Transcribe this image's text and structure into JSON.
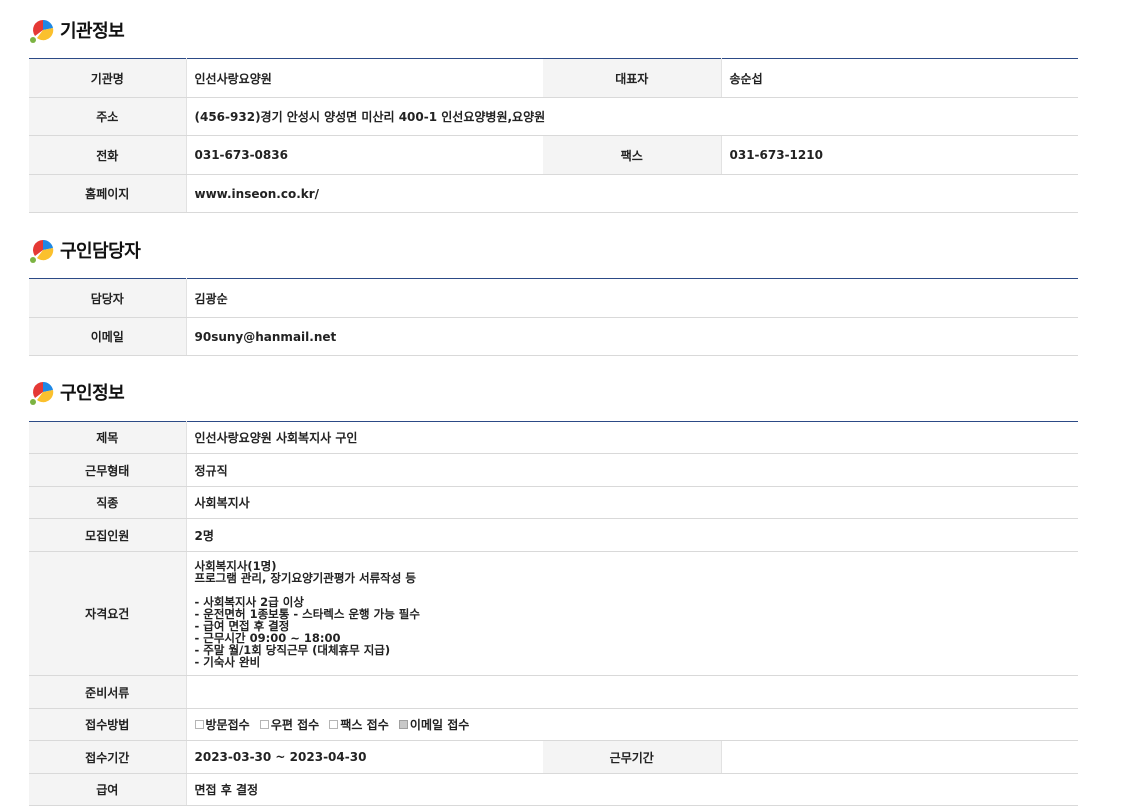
{
  "org_section": {
    "title": "기관정보",
    "name_label": "기관명",
    "name_value": "인선사랑요양원",
    "ceo_label": "대표자",
    "ceo_value": "송순섭",
    "address_label": "주소",
    "address_value": "(456-932)경기 안성시 양성면 미산리 400-1 인선요양병원,요양원",
    "phone_label": "전화",
    "phone_value": "031-673-0836",
    "fax_label": "팩스",
    "fax_value": "031-673-1210",
    "homepage_label": "홈페이지",
    "homepage_value": "www.inseon.co.kr/"
  },
  "contact_section": {
    "title": "구인담당자",
    "manager_label": "담당자",
    "manager_value": "김광순",
    "email_label": "이메일",
    "email_value": "90suny@hanmail.net"
  },
  "job_section": {
    "title": "구인정보",
    "subject_label": "제목",
    "subject_value": "인선사랑요양원 사회복지사 구인",
    "worktype_label": "근무형태",
    "worktype_value": "정규직",
    "jobtype_label": "직종",
    "jobtype_value": "사회복지사",
    "headcount_label": "모집인원",
    "headcount_value": "2명",
    "qualification_label": "자격요건",
    "qualification_value": "사회복지사(1명)\n프로그램 관리, 장기요양기관평가 서류작성 등\n\n- 사회복지사 2급 이상\n- 운전면허 1종보통 - 스타렉스 운행 가능 필수\n- 급여 면접 후 결정\n- 근무시간 09:00 ~ 18:00\n- 주말 월/1회 당직근무 (대체휴무 지급)\n- 기숙사 완비",
    "documents_label": "준비서류",
    "documents_value": "",
    "apply_method_label": "접수방법",
    "apply_methods": [
      {
        "label": "방문접수",
        "checked": false
      },
      {
        "label": "우편 접수",
        "checked": false
      },
      {
        "label": "팩스 접수",
        "checked": false
      },
      {
        "label": "이메일 접수",
        "checked": true
      }
    ],
    "apply_period_label": "접수기간",
    "apply_period_value": "2023-03-30 ~ 2023-04-30",
    "work_period_label": "근무기간",
    "work_period_value": "",
    "salary_label": "급여",
    "salary_value": "면접 후 결정"
  }
}
